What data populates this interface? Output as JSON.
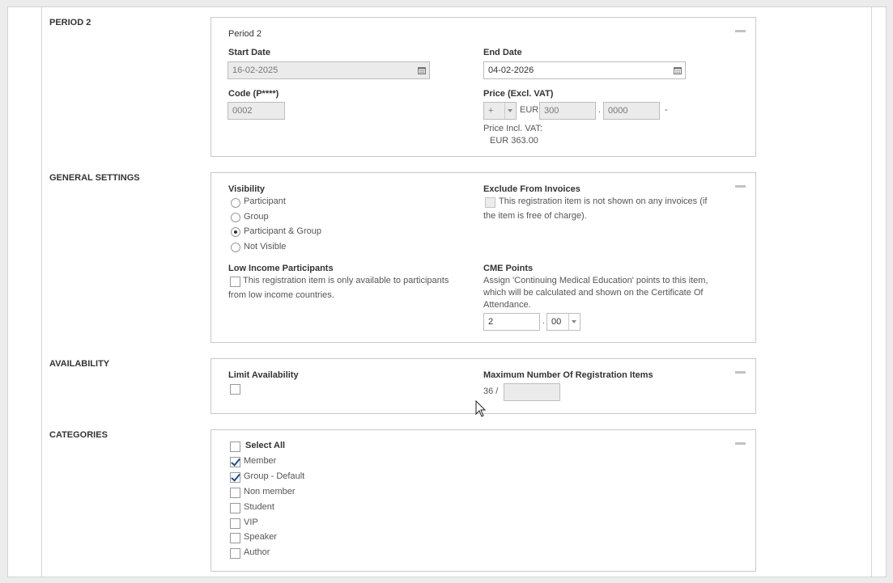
{
  "sections": {
    "period2": "PERIOD 2",
    "general": "GENERAL SETTINGS",
    "availability": "AVAILABILITY",
    "categories": "CATEGORIES"
  },
  "period": {
    "title": "Period 2",
    "start_label": "Start Date",
    "start_value": "16-02-2025",
    "end_label": "End Date",
    "end_value": "04-02-2026",
    "code_label": "Code (P****)",
    "code_value": "0002",
    "price_label": "Price (Excl. VAT)",
    "sign_value": "+",
    "currency": "EUR",
    "price_int": "300",
    "price_sep": ".",
    "price_dec": "0000",
    "price_trail": "-",
    "incl_label": "Price Incl. VAT:",
    "incl_value": "EUR 363.00"
  },
  "general": {
    "visibility_label": "Visibility",
    "visibility_options": [
      "Participant",
      "Group",
      "Participant & Group",
      "Not Visible"
    ],
    "visibility_selected": "Participant & Group",
    "exclude_label": "Exclude From Invoices",
    "exclude_text_1": "This registration item is not shown on any invoices (if",
    "exclude_text_2": "the item is free of charge).",
    "low_income_label": "Low Income Participants",
    "low_income_text_1": "This registration item is only available to participants",
    "low_income_text_2": "from low income countries.",
    "cme_label": "CME Points",
    "cme_text_1": "Assign 'Continuing Medical Education' points to this item,",
    "cme_text_2": "which will be calculated and shown on the Certificate Of",
    "cme_text_3": "Attendance.",
    "cme_int": "2",
    "cme_sep": ".",
    "cme_dec": "00"
  },
  "availability": {
    "limit_label": "Limit Availability",
    "max_label": "Maximum Number Of Registration Items",
    "count": "36 /"
  },
  "categories": {
    "select_all": "Select All",
    "items": [
      {
        "label": "Member",
        "checked": true
      },
      {
        "label": "Group - Default",
        "checked": true
      },
      {
        "label": "Non member",
        "checked": false
      },
      {
        "label": "Student",
        "checked": false
      },
      {
        "label": "VIP",
        "checked": false
      },
      {
        "label": "Speaker",
        "checked": false
      },
      {
        "label": "Author",
        "checked": false
      }
    ]
  },
  "icons": {
    "calendar": "calendar-icon",
    "collapse": "minus-icon",
    "cursor": "mouse-pointer-icon"
  }
}
